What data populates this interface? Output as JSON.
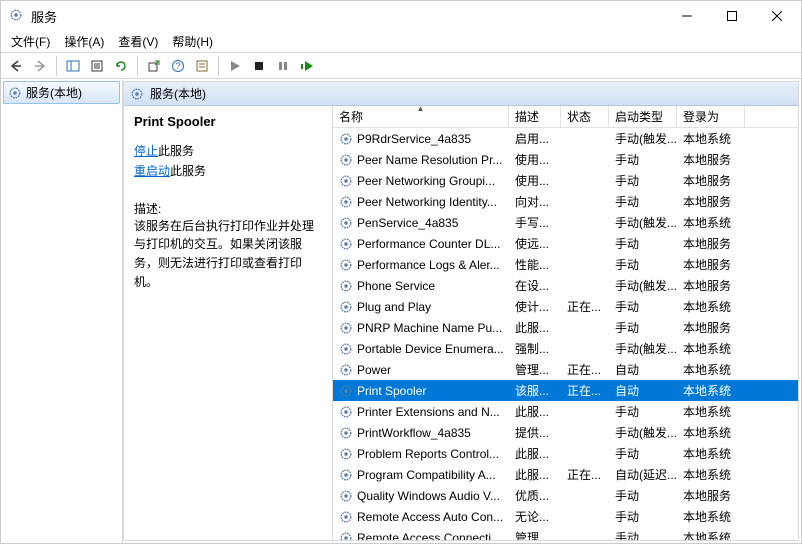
{
  "window": {
    "title": "服务"
  },
  "menu": {
    "file": "文件(F)",
    "action": "操作(A)",
    "view": "查看(V)",
    "help": "帮助(H)"
  },
  "tree": {
    "root": "服务(本地)"
  },
  "groupHeader": "服务(本地)",
  "detail": {
    "title": "Print Spooler",
    "stopLink": "停止",
    "stopSuffix": "此服务",
    "restartLink": "重启动",
    "restartSuffix": "此服务",
    "descLabel": "描述:",
    "desc": "该服务在后台执行打印作业并处理与打印机的交互。如果关闭该服务，则无法进行打印或查看打印机。"
  },
  "columns": {
    "name": "名称",
    "desc": "描述",
    "status": "状态",
    "startup": "启动类型",
    "logon": "登录为"
  },
  "rows": [
    {
      "name": "P9RdrService_4a835",
      "desc": "启用...",
      "status": "",
      "startup": "手动(触发...",
      "logon": "本地系统",
      "sel": false
    },
    {
      "name": "Peer Name Resolution Pr...",
      "desc": "使用...",
      "status": "",
      "startup": "手动",
      "logon": "本地服务",
      "sel": false
    },
    {
      "name": "Peer Networking Groupi...",
      "desc": "使用...",
      "status": "",
      "startup": "手动",
      "logon": "本地服务",
      "sel": false
    },
    {
      "name": "Peer Networking Identity...",
      "desc": "向对...",
      "status": "",
      "startup": "手动",
      "logon": "本地服务",
      "sel": false
    },
    {
      "name": "PenService_4a835",
      "desc": "手写...",
      "status": "",
      "startup": "手动(触发...",
      "logon": "本地系统",
      "sel": false
    },
    {
      "name": "Performance Counter DL...",
      "desc": "使远...",
      "status": "",
      "startup": "手动",
      "logon": "本地服务",
      "sel": false
    },
    {
      "name": "Performance Logs & Aler...",
      "desc": "性能...",
      "status": "",
      "startup": "手动",
      "logon": "本地服务",
      "sel": false
    },
    {
      "name": "Phone Service",
      "desc": "在设...",
      "status": "",
      "startup": "手动(触发...",
      "logon": "本地服务",
      "sel": false
    },
    {
      "name": "Plug and Play",
      "desc": "使计...",
      "status": "正在...",
      "startup": "手动",
      "logon": "本地系统",
      "sel": false
    },
    {
      "name": "PNRP Machine Name Pu...",
      "desc": "此服...",
      "status": "",
      "startup": "手动",
      "logon": "本地服务",
      "sel": false
    },
    {
      "name": "Portable Device Enumera...",
      "desc": "强制...",
      "status": "",
      "startup": "手动(触发...",
      "logon": "本地系统",
      "sel": false
    },
    {
      "name": "Power",
      "desc": "管理...",
      "status": "正在...",
      "startup": "自动",
      "logon": "本地系统",
      "sel": false
    },
    {
      "name": "Print Spooler",
      "desc": "该服...",
      "status": "正在...",
      "startup": "自动",
      "logon": "本地系统",
      "sel": true
    },
    {
      "name": "Printer Extensions and N...",
      "desc": "此服...",
      "status": "",
      "startup": "手动",
      "logon": "本地系统",
      "sel": false
    },
    {
      "name": "PrintWorkflow_4a835",
      "desc": "提供...",
      "status": "",
      "startup": "手动(触发...",
      "logon": "本地系统",
      "sel": false
    },
    {
      "name": "Problem Reports Control...",
      "desc": "此服...",
      "status": "",
      "startup": "手动",
      "logon": "本地系统",
      "sel": false
    },
    {
      "name": "Program Compatibility A...",
      "desc": "此服...",
      "status": "正在...",
      "startup": "自动(延迟...",
      "logon": "本地系统",
      "sel": false
    },
    {
      "name": "Quality Windows Audio V...",
      "desc": "优质...",
      "status": "",
      "startup": "手动",
      "logon": "本地服务",
      "sel": false
    },
    {
      "name": "Remote Access Auto Con...",
      "desc": "无论...",
      "status": "",
      "startup": "手动",
      "logon": "本地系统",
      "sel": false
    },
    {
      "name": "Remote Access Connecti...",
      "desc": "管理...",
      "status": "",
      "startup": "手动",
      "logon": "本地系统",
      "sel": false
    }
  ]
}
